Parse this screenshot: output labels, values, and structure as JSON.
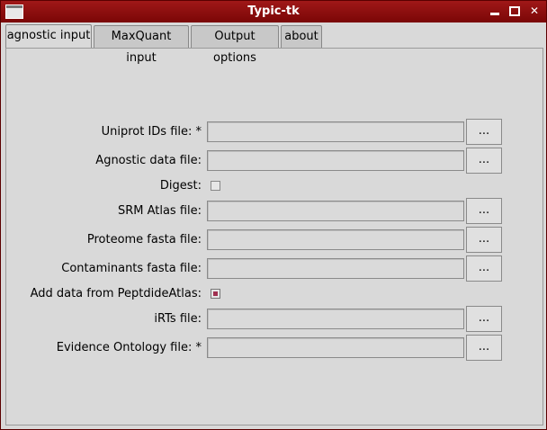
{
  "window": {
    "title": "Typic-tk"
  },
  "tabs": [
    {
      "label": "agnostic input",
      "active": true
    },
    {
      "label": "MaxQuant input",
      "active": false
    },
    {
      "label": "Output options",
      "active": false
    },
    {
      "label": "about",
      "active": false
    }
  ],
  "form": {
    "uniprot_label": "Uniprot IDs file: *",
    "agnostic_label": "Agnostic data file:",
    "digest_label": "Digest:",
    "srm_label": "SRM Atlas file:",
    "proteome_label": "Proteome fasta file:",
    "contaminants_label": "Contaminants fasta file:",
    "peptideatlas_label": "Add data from PeptdideAtlas:",
    "irts_label": "iRTs file:",
    "evidence_label": "Evidence Ontology file: *",
    "browse_label": "...",
    "digest_checked": false,
    "peptideatlas_checked": true
  }
}
